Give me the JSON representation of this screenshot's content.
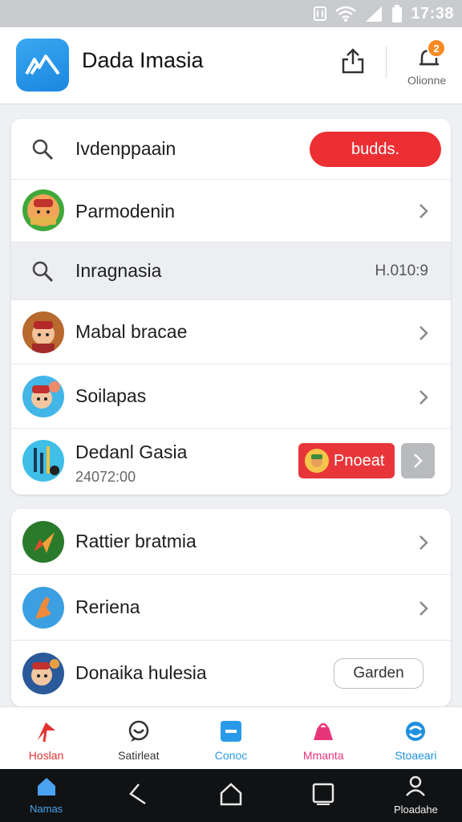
{
  "status_bar": {
    "time": "17:38"
  },
  "header": {
    "title": "Dada Imasia",
    "notification_count": "2",
    "notification_label": "Olionne"
  },
  "card1": {
    "search_row": {
      "placeholder": "Ivdenppaain",
      "button_label": "budds."
    },
    "row_1": {
      "label": "Parmodenin"
    },
    "search_row_2": {
      "label": "Inragnasia",
      "value": "H.010:9"
    },
    "row_2": {
      "label": "Mabal bracae"
    },
    "row_3": {
      "label": "Soilapas"
    },
    "row_4": {
      "label": "Dedanl Gasia",
      "sublabel": "24072:00",
      "button_label": "Pnoeat"
    }
  },
  "card2": {
    "row_1": {
      "label": "Rattier bratmia"
    },
    "row_2": {
      "label": "Reriena"
    },
    "row_3": {
      "label": "Donaika hulesia",
      "button_label": "Garden"
    }
  },
  "tabs": [
    {
      "label": "Hoslan",
      "icon": "play-icon",
      "color": "#e23232"
    },
    {
      "label": "Satirleat",
      "icon": "chat-icon",
      "color": "#333333"
    },
    {
      "label": "Conoc",
      "icon": "tv-icon",
      "color": "#2a9ae8"
    },
    {
      "label": "Mmanta",
      "icon": "bag-icon",
      "color": "#e8357a"
    },
    {
      "label": "Stoaeari",
      "icon": "sync-icon",
      "color": "#1e90e0"
    }
  ],
  "nav": [
    {
      "label": "Namas"
    },
    {
      "label": ""
    },
    {
      "label": ""
    },
    {
      "label": ""
    },
    {
      "label": "Ploadahe"
    }
  ],
  "colors": {
    "accent_red": "#ec2f33",
    "brand_blue": "#2a9ae8"
  }
}
